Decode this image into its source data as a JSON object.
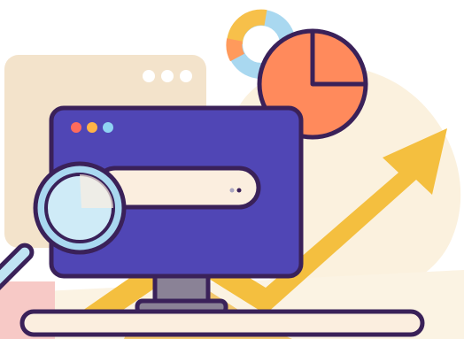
{
  "illustration": {
    "subject": "search-analytics-monitor",
    "icons": [
      "search-icon",
      "pie-chart-icon",
      "donut-chart-icon",
      "trend-arrow-icon",
      "browser-window-icon"
    ],
    "colors": {
      "outline": "#3A2159",
      "monitor": "#5046B5",
      "search_bar": "#FBEEDF",
      "magnifier_lens": "#BFE3F3",
      "pie_chart": "#FF8A5C",
      "arrow": "#F4BF3F",
      "window_bg": "#F3E3CB",
      "blob_bg": "#FBF1DE",
      "stand": "#8A8296",
      "dot_red": "#FF6B5C",
      "dot_orange": "#FFB347",
      "dot_blue": "#8FD3F3",
      "donut_blue": "#A9D8F0",
      "donut_orange": "#FF9A5C",
      "donut_yellow": "#F7C04A"
    }
  }
}
